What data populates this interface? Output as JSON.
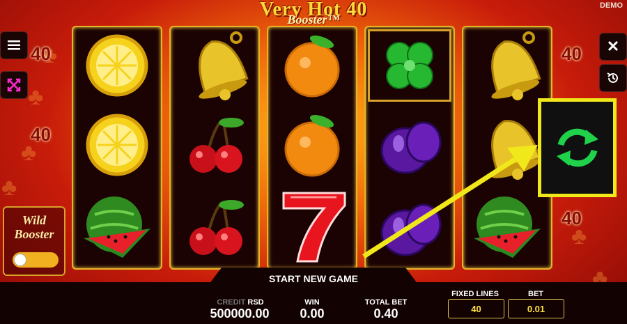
{
  "title": {
    "main": "Very Hot 40",
    "sub": "Booster™"
  },
  "demo_label": "DEMO",
  "multipliers": [
    "40",
    "40",
    "40",
    "40",
    "40"
  ],
  "reels": [
    [
      "lemon",
      "lemon",
      "watermelon"
    ],
    [
      "bell",
      "cherries",
      "cherries"
    ],
    [
      "orange",
      "orange",
      "seven"
    ],
    [
      "clover",
      "plum",
      "plum"
    ],
    [
      "bell",
      "bell",
      "watermelon"
    ]
  ],
  "wild_booster": {
    "line1": "Wild",
    "line2": "Booster"
  },
  "start_label": "START NEW GAME",
  "credit": {
    "label": "CREDIT",
    "currency": "RSD",
    "value": "500000.00"
  },
  "win": {
    "label": "WIN",
    "value": "0.00"
  },
  "total_bet": {
    "label": "TOTAL BET",
    "value": "0.40"
  },
  "fixed_lines": {
    "label": "FIXED LINES",
    "value": "40"
  },
  "bet": {
    "label": "BET",
    "value": "0.01"
  },
  "icons": {
    "menu": "menu-icon",
    "fullscreen": "fullscreen-icon",
    "close": "close-icon",
    "history": "history-icon",
    "refresh": "refresh-icon"
  },
  "colors": {
    "highlight": "#f0e81a",
    "reel_border": "#e6b428",
    "refresh": "#1fd24a"
  }
}
